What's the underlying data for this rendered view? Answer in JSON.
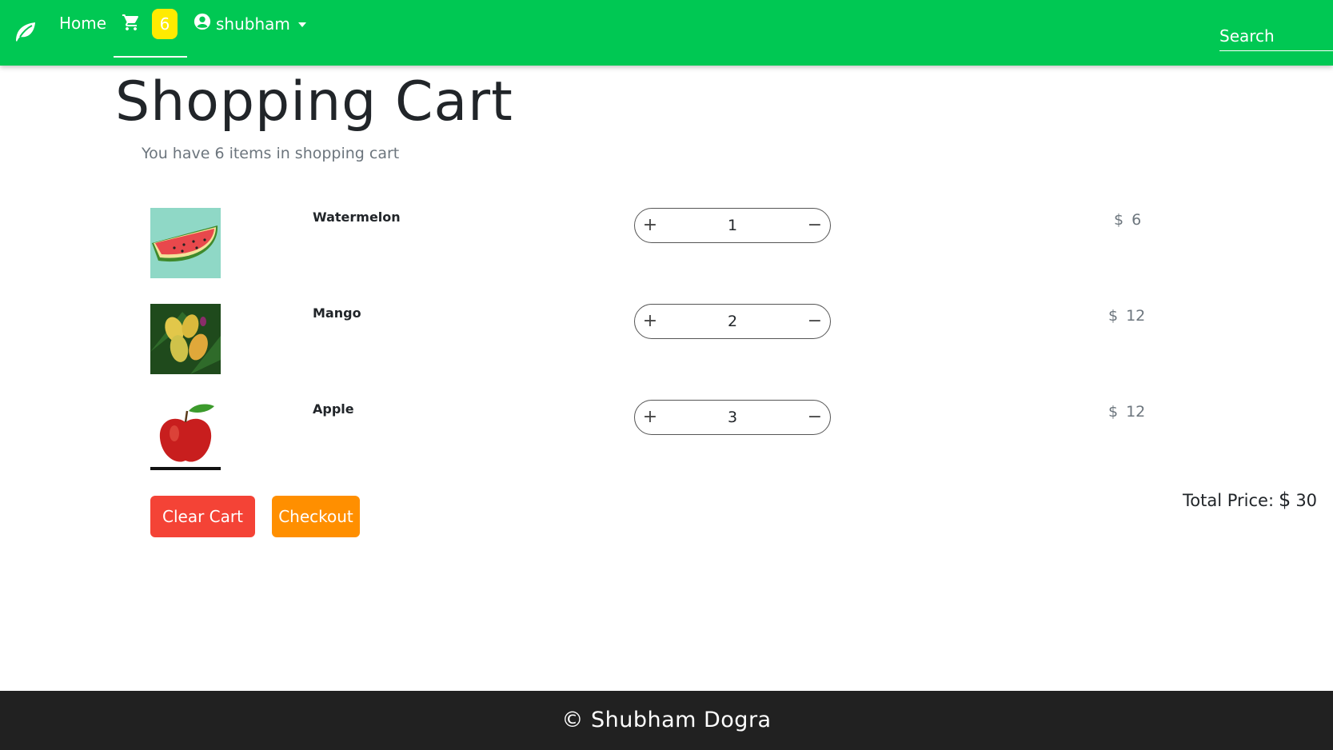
{
  "nav": {
    "home_label": "Home",
    "cart_count": "6",
    "user_name": "shubham",
    "search_placeholder": "Search",
    "brand_color": "#00c853",
    "badge_color": "#ffeb00"
  },
  "main": {
    "title": "Shopping Cart",
    "subtitle": "You have 6 items in shopping cart",
    "items": [
      {
        "name": "Watermelon",
        "quantity": "1",
        "currency": "$",
        "price": "6"
      },
      {
        "name": "Mango",
        "quantity": "2",
        "currency": "$",
        "price": "12"
      },
      {
        "name": "Apple",
        "quantity": "3",
        "currency": "$",
        "price": "12"
      }
    ],
    "stepper_plus": "+",
    "stepper_minus": "−",
    "clear_label": "Clear Cart",
    "checkout_label": "Checkout",
    "total_label": "Total Price:",
    "total_currency": "$",
    "total_value": "30",
    "clear_color": "#f44336",
    "checkout_color": "#ff8f00"
  },
  "footer": {
    "text": "© Shubham Dogra"
  }
}
